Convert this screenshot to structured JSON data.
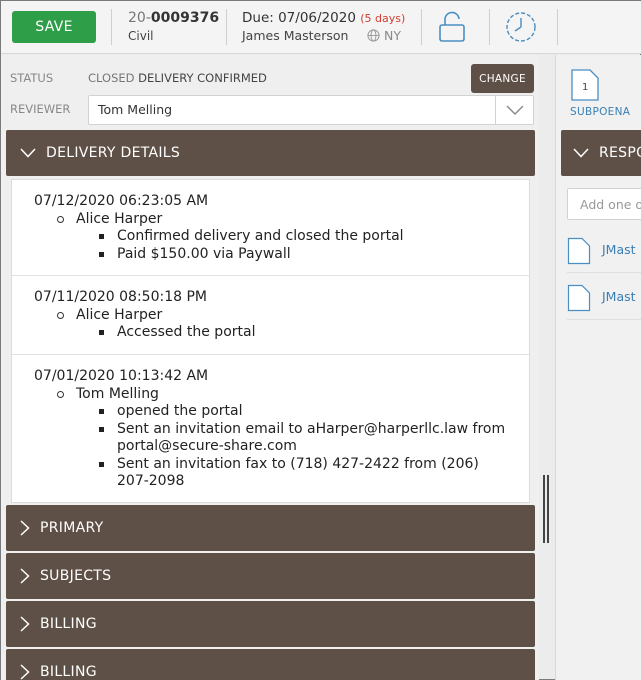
{
  "header": {
    "save_label": "SAVE",
    "case_prefix": "20-",
    "case_number": "0009376",
    "case_type": "Civil",
    "due_label": "Due: 07/06/2020",
    "due_days": "(5 days)",
    "assignee": "James Masterson",
    "location": "NY"
  },
  "status": {
    "label": "STATUS",
    "value_closed": "CLOSED",
    "value_state": "DELIVERY CONFIRMED",
    "change_label": "CHANGE"
  },
  "reviewer": {
    "label": "REVIEWER",
    "value": "Tom Melling"
  },
  "sections": {
    "delivery_details": "DELIVERY DETAILS",
    "primary": "PRIMARY",
    "subjects": "SUBJECTS",
    "billing_1": "BILLING",
    "billing_2": "BILLING"
  },
  "log": [
    {
      "timestamp": "07/12/2020 06:23:05 AM",
      "actor": "Alice Harper",
      "actions": [
        "Confirmed delivery and closed the portal",
        "Paid $150.00 via Paywall"
      ]
    },
    {
      "timestamp": "07/11/2020 08:50:18 PM",
      "actor": "Alice Harper",
      "actions": [
        "Accessed the portal"
      ]
    },
    {
      "timestamp": "07/01/2020 10:13:42 AM",
      "actor": "Tom Melling",
      "actions": [
        "opened the portal",
        "Sent an invitation email to aHarper@harperllc.law from portal@secure-share.com",
        "Sent an invitation fax to (718) 427-2422 from (206) 207-2098"
      ]
    }
  ],
  "right": {
    "subpoena_count": "1",
    "subpoena_label": "SUBPOENA",
    "response_title": "RESPO",
    "add_placeholder": "Add one o",
    "files": [
      "JMast",
      "JMast"
    ]
  },
  "colors": {
    "save_green": "#2e9e48",
    "section_brown": "#5e5046",
    "link_blue": "#3a7fb4",
    "days_red": "#d33c2f"
  }
}
